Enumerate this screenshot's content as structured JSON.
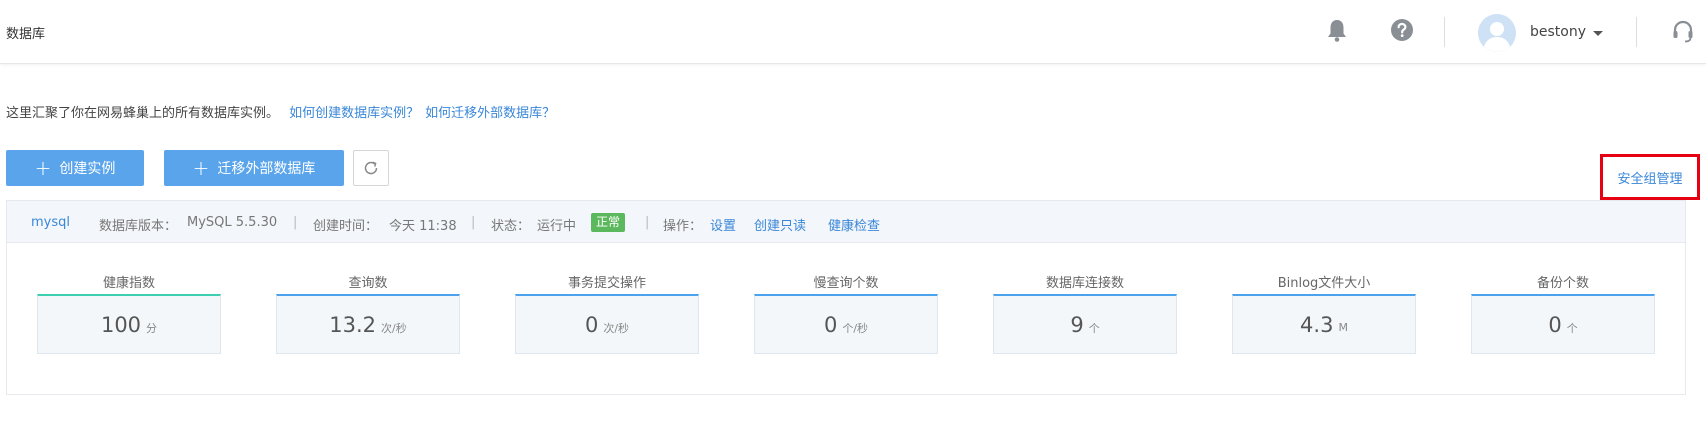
{
  "header": {
    "title": "数据库",
    "username": "bestony"
  },
  "intro": {
    "text": "这里汇聚了你在网易蜂巢上的所有数据库实例。",
    "link_create": "如何创建数据库实例？",
    "link_migrate": "如何迁移外部数据库？"
  },
  "toolbar": {
    "create_label": "创建实例",
    "migrate_label": "迁移外部数据库",
    "plus": "+",
    "security_group": "安全组管理"
  },
  "instance": {
    "name": "mysql",
    "version_label": "数据库版本：",
    "version": "MySQL 5.5.30",
    "sep": "|",
    "created_label": "创建时间：",
    "created": "今天 11:38",
    "status_label": "状态：",
    "status": "运行中",
    "status_badge": "正常",
    "ops_label": "操作：",
    "ops": [
      "设置",
      "创建只读",
      "健康检查"
    ]
  },
  "metrics": [
    {
      "label": "健康指数",
      "value": "100",
      "unit": "分"
    },
    {
      "label": "查询数",
      "value": "13.2",
      "unit": "次/秒"
    },
    {
      "label": "事务提交操作",
      "value": "0",
      "unit": "次/秒"
    },
    {
      "label": "慢查询个数",
      "value": "0",
      "unit": "个/秒"
    },
    {
      "label": "数据库连接数",
      "value": "9",
      "unit": "个"
    },
    {
      "label": "Binlog文件大小",
      "value": "4.3",
      "unit": "M"
    },
    {
      "label": "备份个数",
      "value": "0",
      "unit": "个"
    }
  ],
  "colors": {
    "accent": "#5aa4ec",
    "link": "#3a87d8",
    "status_ok": "#5cb85c",
    "highlight": "#e60012"
  }
}
